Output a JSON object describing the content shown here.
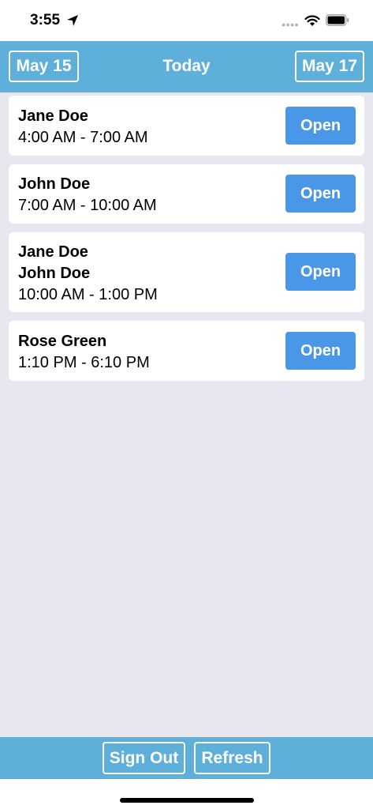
{
  "status_bar": {
    "time": "3:55",
    "icons": [
      "location-arrow-icon",
      "signal-dots-icon",
      "wifi-icon",
      "battery-icon"
    ]
  },
  "nav": {
    "prev_label": "May 15",
    "title": "Today",
    "next_label": "May 17"
  },
  "shifts": [
    {
      "names": [
        "Jane Doe"
      ],
      "time": "4:00 AM - 7:00 AM",
      "button": "Open"
    },
    {
      "names": [
        "John Doe"
      ],
      "time": "7:00 AM - 10:00 AM",
      "button": "Open"
    },
    {
      "names": [
        "Jane Doe",
        "John Doe"
      ],
      "time": "10:00 AM - 1:00 PM",
      "button": "Open"
    },
    {
      "names": [
        "Rose Green"
      ],
      "time": "1:10 PM - 6:10 PM",
      "button": "Open"
    }
  ],
  "footer": {
    "sign_out_label": "Sign Out",
    "refresh_label": "Refresh"
  },
  "colors": {
    "bar": "#5eafd9",
    "button": "#4a97e8",
    "background": "#e8e7f0"
  }
}
